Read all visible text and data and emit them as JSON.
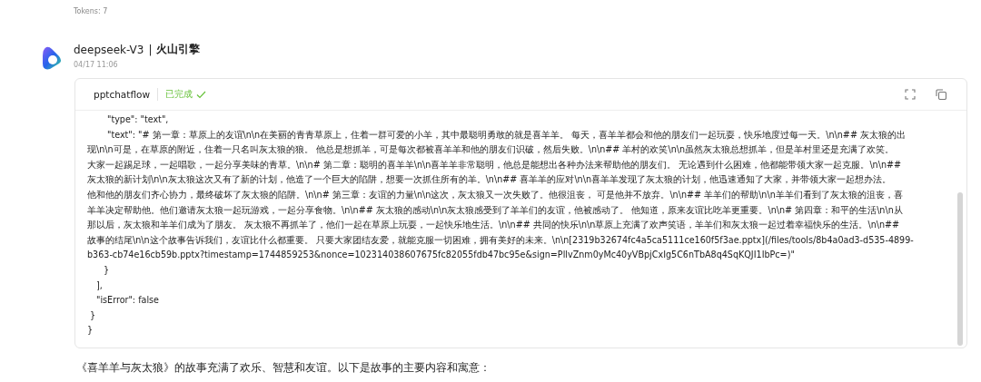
{
  "tokens": "Tokens: 7",
  "message": {
    "model": "deepseek-V3",
    "separator": "|",
    "provider": "火山引擎",
    "time": "04/17 11:06"
  },
  "tool_card": {
    "name": "pptchatflow",
    "status": "已完成",
    "completed": true,
    "lines": [
      {
        "kind": "field",
        "text": "\"type\": \"text\","
      },
      {
        "kind": "field",
        "text": "\"text\": \"# 第一章：草原上的友谊\\n\\n在美丽的青青草原上，住着一群可爱的小羊，其中最聪明勇敢的就是喜羊羊。 每天，喜羊羊都会和他的朋友们一起玩耍，快乐地度过每一天。\\n\\n## 灰太狼的出"
      },
      {
        "kind": "wrap",
        "text": "现\\n\\n可是，在草原的附近，住着一只名叫灰太狼的狼。 他总是想抓羊，可是每次都被喜羊羊和他的朋友们识破，然后失败。\\n\\n## 羊村的欢笑\\n\\n虽然灰太狼总想抓羊，但是羊村里还是充满了欢笑。"
      },
      {
        "kind": "wrap",
        "text": "大家一起踢足球，一起唱歌，一起分享美味的青草。\\n\\n# 第二章：聪明的喜羊羊\\n\\n喜羊羊非常聪明，他总是能想出各种办法来帮助他的朋友们。 无论遇到什么困难，他都能带领大家一起克服。\\n\\n##"
      },
      {
        "kind": "wrap",
        "text": "灰太狼的新计划\\n\\n灰太狼这次又有了新的计划，他造了一个巨大的陷阱，想要一次抓住所有的羊。\\n\\n## 喜羊羊的应对\\n\\n喜羊羊发现了灰太狼的计划，他迅速通知了大家，并带领大家一起想办法。"
      },
      {
        "kind": "wrap",
        "text": "他和他的朋友们齐心协力，最终破坏了灰太狼的陷阱。\\n\\n# 第三章：友谊的力量\\n\\n这次，灰太狼又一次失败了。他很沮丧， 可是他并不放弃。\\n\\n## 羊羊们的帮助\\n\\n羊羊们看到了灰太狼的沮丧，喜"
      },
      {
        "kind": "wrap",
        "text": "羊羊决定帮助他。他们邀请灰太狼一起玩游戏，一起分享食物。\\n\\n## 灰太狼的感动\\n\\n灰太狼感受到了羊羊们的友谊，他被感动了。 他知道，原来友谊比吃羊更重要。\\n\\n# 第四章：和平的生活\\n\\n从"
      },
      {
        "kind": "wrap",
        "text": "那以后，灰太狼和羊羊们成为了朋友。 灰太狼不再抓羊了，他们一起在草原上玩耍，一起快乐地生活。\\n\\n## 共同的快乐\\n\\n草原上充满了欢声笑语，羊羊们和灰太狼一起过着幸福快乐的生活。\\n\\n##"
      },
      {
        "kind": "wrap",
        "text": "故事的结尾\\n\\n这个故事告诉我们，友谊比什么都重要。 只要大家团结友爱，就能克服一切困难，拥有美好的未来。\\n\\n[2319b32674fc4a5ca5111ce160f5f3ae.pptx](/files/tools/8b4a0ad3-d535-4899-"
      },
      {
        "kind": "wrap",
        "text": "b363-cb74e16cb59b.pptx?timestamp=1744859253&nonce=102314038607675fc82055fdb47bc95e&sign=PllvZnm0yMc40yVBpjCxIg5C6nTbA8q4SqKQJI1IbPc=)\""
      },
      {
        "kind": "inner-close",
        "text": "}"
      },
      {
        "kind": "member",
        "text": "],"
      },
      {
        "kind": "member",
        "text": "\"isError\": false"
      },
      {
        "kind": "object-close",
        "text": "}"
      },
      {
        "kind": "root-close",
        "text": "}"
      }
    ]
  },
  "reply": "《喜羊羊与灰太狼》的故事充满了欢乐、智慧和友谊。以下是故事的主要内容和寓意："
}
